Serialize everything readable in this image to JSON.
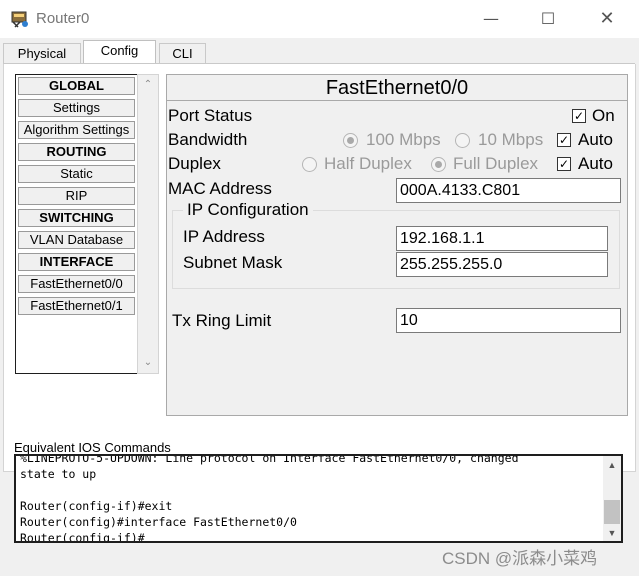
{
  "window": {
    "title": "Router0",
    "minimize_glyph": "—",
    "maximize_glyph": "☐",
    "close_glyph": "✕"
  },
  "tabs": [
    {
      "label": "Physical"
    },
    {
      "label": "Config"
    },
    {
      "label": "CLI"
    }
  ],
  "sidebar": {
    "items": [
      {
        "label": "GLOBAL",
        "type": "header"
      },
      {
        "label": "Settings",
        "type": "item"
      },
      {
        "label": "Algorithm Settings",
        "type": "item"
      },
      {
        "label": "ROUTING",
        "type": "header"
      },
      {
        "label": "Static",
        "type": "item"
      },
      {
        "label": "RIP",
        "type": "item"
      },
      {
        "label": "SWITCHING",
        "type": "header"
      },
      {
        "label": "VLAN Database",
        "type": "item"
      },
      {
        "label": "INTERFACE",
        "type": "header"
      },
      {
        "label": "FastEthernet0/0",
        "type": "item"
      },
      {
        "label": "FastEthernet0/1",
        "type": "item"
      }
    ],
    "scroll_up": "⌃",
    "scroll_down": "⌄"
  },
  "interface": {
    "title": "FastEthernet0/0",
    "port_status": {
      "label": "Port Status",
      "checkbox_label": "On",
      "checked": true
    },
    "bandwidth": {
      "label": "Bandwidth",
      "option_100": "100 Mbps",
      "option_10": "10 Mbps",
      "selected": "100 Mbps",
      "auto_label": "Auto",
      "auto_checked": true
    },
    "duplex": {
      "label": "Duplex",
      "option_half": "Half Duplex",
      "option_full": "Full Duplex",
      "selected": "Full Duplex",
      "auto_label": "Auto",
      "auto_checked": true
    },
    "mac": {
      "label": "MAC Address",
      "value": "000A.4133.C801"
    },
    "ip_config": {
      "legend": "IP Configuration",
      "ip_label": "IP Address",
      "ip_value": "192.168.1.1",
      "mask_label": "Subnet Mask",
      "mask_value": "255.255.255.0"
    },
    "tx_ring": {
      "label": "Tx Ring Limit",
      "value": "10"
    }
  },
  "ios": {
    "label": "Equivalent IOS Commands",
    "lines": [
      "%LINEPROTO-5-UPDOWN: Line protocol on Interface FastEthernet0/0, changed",
      "state to up",
      "",
      "Router(config-if)#exit",
      "Router(config)#interface FastEthernet0/0",
      "Router(config-if)#"
    ]
  },
  "watermark": "CSDN @派森小菜鸡",
  "colors": {
    "check": "#000000",
    "disabled_text": "#9a9a9a",
    "panel_bg": "#f0f0f0"
  }
}
